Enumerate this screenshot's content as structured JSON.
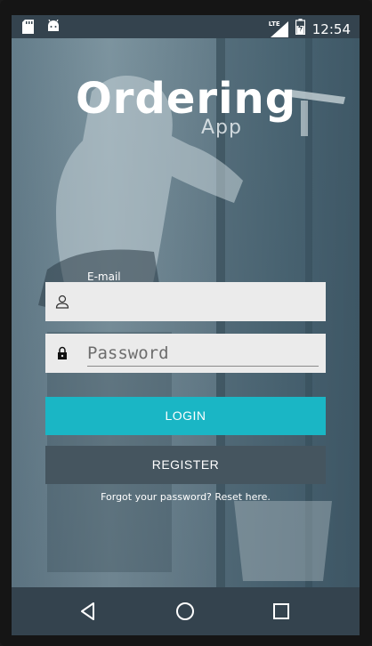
{
  "status_bar": {
    "network": "LTE",
    "time": "12:54",
    "icons": [
      "sd-card-icon",
      "android-icon",
      "signal-icon",
      "battery-icon"
    ]
  },
  "logo": {
    "title": "Ordering",
    "subtitle": "App"
  },
  "form": {
    "email_label": "E-mail",
    "email_value": "",
    "password_placeholder": "Password",
    "login_label": "LOGIN",
    "register_label": "REGISTER",
    "forgot_text": "Forgot your password? Reset here."
  },
  "colors": {
    "accent": "#1ab6c5",
    "register": "#45555f",
    "bars": "#34434e"
  },
  "nav_bar": {
    "icons": [
      "back-icon",
      "home-icon",
      "recent-apps-icon"
    ]
  }
}
